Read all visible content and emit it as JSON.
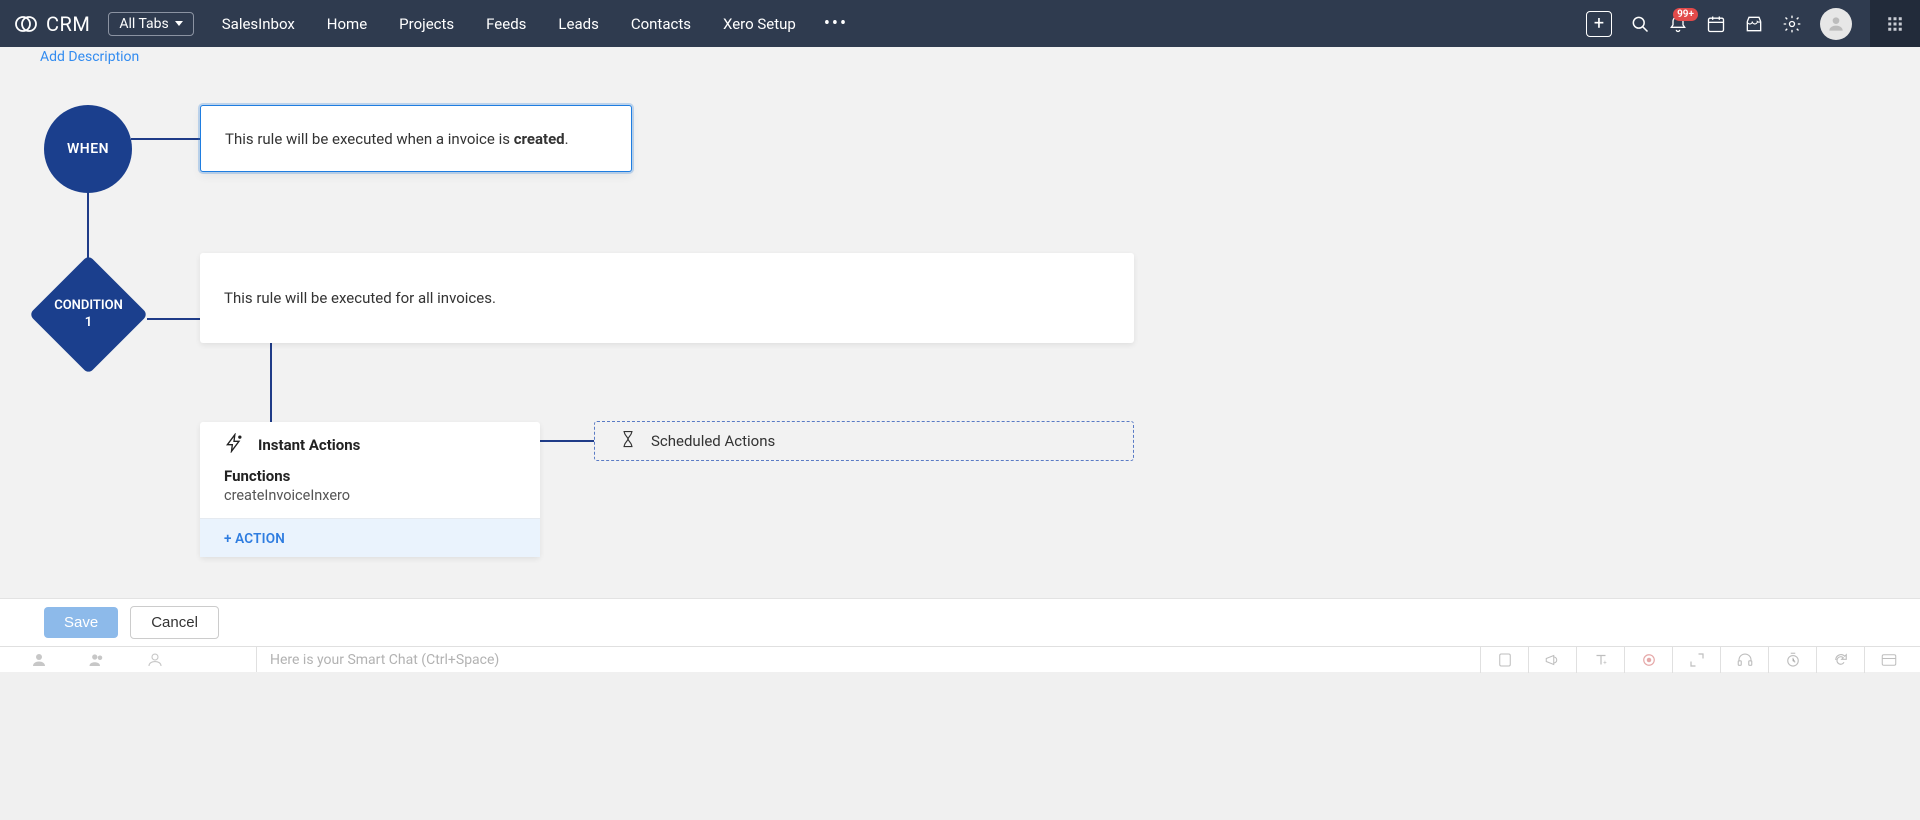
{
  "nav": {
    "brand": "CRM",
    "all_tabs": "All Tabs",
    "links": [
      "SalesInbox",
      "Home",
      "Projects",
      "Feeds",
      "Leads",
      "Contacts",
      "Xero Setup"
    ],
    "badge": "99+"
  },
  "canvas": {
    "add_description": "Add Description",
    "when_label": "WHEN",
    "when_text_prefix": "This rule will be executed when a invoice is ",
    "when_text_bold": "created",
    "when_text_suffix": ".",
    "condition_label_l1": "CONDITION",
    "condition_label_l2": "1",
    "condition_text": "This rule will be executed for all invoices.",
    "instant_title": "Instant Actions",
    "functions_label": "Functions",
    "function_name": "createInvoiceInxero",
    "add_action": "+ ACTION",
    "scheduled_title": "Scheduled Actions"
  },
  "footer": {
    "save": "Save",
    "cancel": "Cancel",
    "chat_placeholder": "Here is your Smart Chat (Ctrl+Space)"
  }
}
